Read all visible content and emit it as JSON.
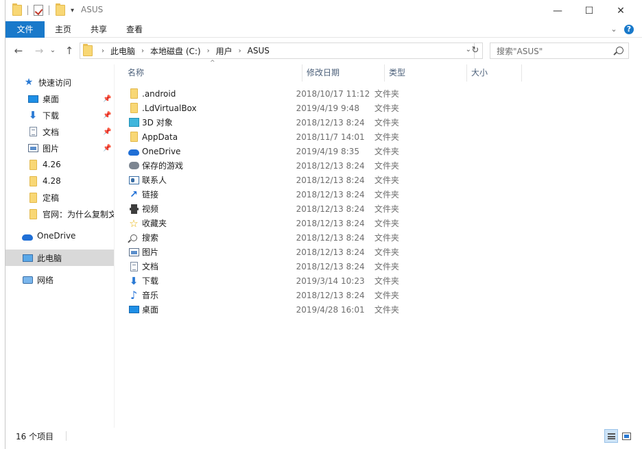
{
  "window": {
    "title": "ASUS",
    "minimize": "—",
    "maximize": "☐",
    "close": "✕"
  },
  "ribbon": {
    "tabs": [
      "文件",
      "主页",
      "共享",
      "查看"
    ],
    "collapse": "⌄",
    "help": "?"
  },
  "nav_buttons": {
    "back": "←",
    "forward": "→",
    "recent": "⌄",
    "up": "↑"
  },
  "address": {
    "crumbs": [
      "此电脑",
      "本地磁盘 (C:)",
      "用户",
      "ASUS"
    ],
    "dropdown": "⌄",
    "refresh": "↻"
  },
  "search": {
    "placeholder": "搜索\"ASUS\""
  },
  "navpane": {
    "quick_access": "快速访问",
    "pinned": [
      {
        "label": "桌面",
        "icon": "desktop-icon",
        "pinned": true
      },
      {
        "label": "下载",
        "icon": "download-icon",
        "pinned": true
      },
      {
        "label": "文档",
        "icon": "document-icon",
        "pinned": true
      },
      {
        "label": "图片",
        "icon": "pictures-icon",
        "pinned": true
      },
      {
        "label": "4.26",
        "icon": "folder-icon",
        "pinned": false
      },
      {
        "label": "4.28",
        "icon": "folder-icon",
        "pinned": false
      },
      {
        "label": "定稿",
        "icon": "folder-icon",
        "pinned": false
      },
      {
        "label": "官网：为什么复制文",
        "icon": "folder-icon",
        "pinned": false
      }
    ],
    "onedrive": "OneDrive",
    "this_pc": "此电脑",
    "network": "网络",
    "pin_glyph": "📌"
  },
  "columns": {
    "name": "名称",
    "date": "修改日期",
    "type": "类型",
    "size": "大小",
    "sort_indicator": "^"
  },
  "files": [
    {
      "name": ".android",
      "date": "2018/10/17 11:12",
      "type": "文件夹",
      "icon": "folder-icon"
    },
    {
      "name": ".LdVirtualBox",
      "date": "2019/4/19 9:48",
      "type": "文件夹",
      "icon": "folder-icon"
    },
    {
      "name": "3D 对象",
      "date": "2018/12/13 8:24",
      "type": "文件夹",
      "icon": "3d-objects-icon"
    },
    {
      "name": "AppData",
      "date": "2018/11/7 14:01",
      "type": "文件夹",
      "icon": "folder-icon"
    },
    {
      "name": "OneDrive",
      "date": "2019/4/19 8:35",
      "type": "文件夹",
      "icon": "onedrive-icon"
    },
    {
      "name": "保存的游戏",
      "date": "2018/12/13 8:24",
      "type": "文件夹",
      "icon": "saved-games-icon"
    },
    {
      "name": "联系人",
      "date": "2018/12/13 8:24",
      "type": "文件夹",
      "icon": "contacts-icon"
    },
    {
      "name": "链接",
      "date": "2018/12/13 8:24",
      "type": "文件夹",
      "icon": "links-icon"
    },
    {
      "name": "视频",
      "date": "2018/12/13 8:24",
      "type": "文件夹",
      "icon": "videos-icon"
    },
    {
      "name": "收藏夹",
      "date": "2018/12/13 8:24",
      "type": "文件夹",
      "icon": "favorites-icon"
    },
    {
      "name": "搜索",
      "date": "2018/12/13 8:24",
      "type": "文件夹",
      "icon": "searches-icon"
    },
    {
      "name": "图片",
      "date": "2018/12/13 8:24",
      "type": "文件夹",
      "icon": "pictures-icon"
    },
    {
      "name": "文档",
      "date": "2018/12/13 8:24",
      "type": "文件夹",
      "icon": "document-icon"
    },
    {
      "name": "下载",
      "date": "2019/3/14 10:23",
      "type": "文件夹",
      "icon": "download-icon"
    },
    {
      "name": "音乐",
      "date": "2018/12/13 8:24",
      "type": "文件夹",
      "icon": "music-icon"
    },
    {
      "name": "桌面",
      "date": "2019/4/28 16:01",
      "type": "文件夹",
      "icon": "desktop-icon"
    }
  ],
  "status": {
    "item_count": "16 个项目"
  },
  "colors": {
    "accent": "#1979ca",
    "folder": "#f8d775",
    "selected": "#d9d9d9"
  }
}
